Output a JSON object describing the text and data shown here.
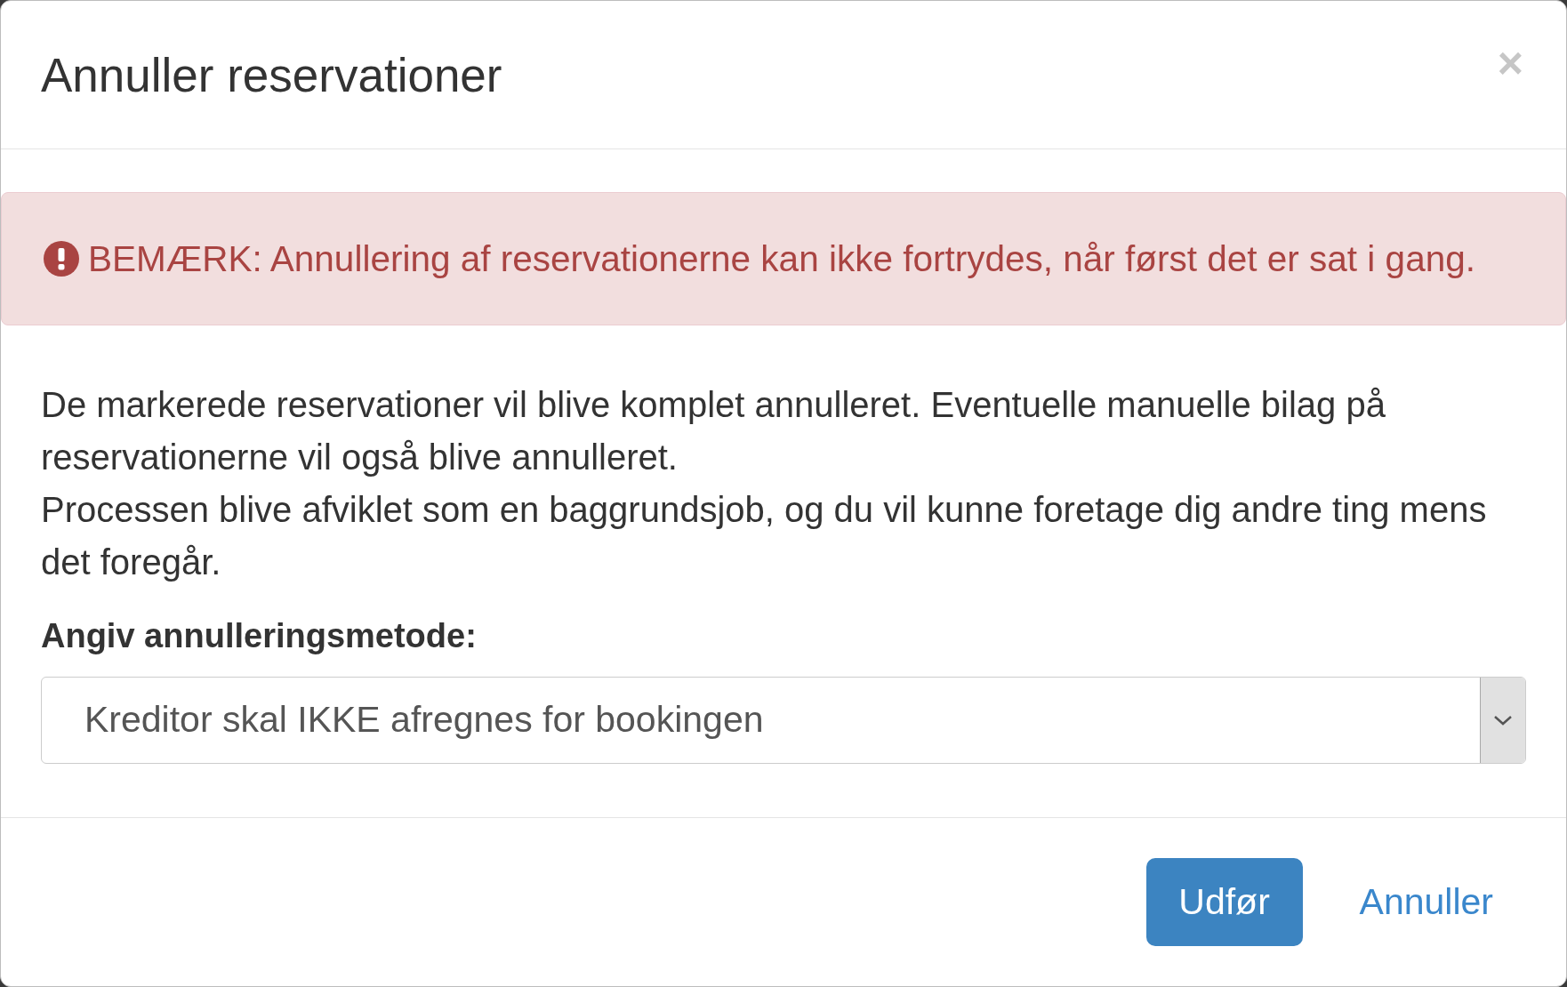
{
  "dialog": {
    "title": "Annuller reservationer",
    "close_button": "×"
  },
  "alert": {
    "kind": "danger",
    "text": "BEMÆRK: Annullering af reservationerne kan ikke fortrydes, når først det er sat i gang."
  },
  "description": [
    "De markerede reservationer vil blive komplet annulleret. Eventuelle manuelle bilag på reservationerne vil også blive annulleret.",
    "Processen blive afviklet som en baggrundsjob, og du vil kunne foretage dig andre ting mens det foregår."
  ],
  "cancellation_method": {
    "label": "Angiv annulleringsmetode:",
    "value": "Kreditor skal IKKE afregnes for bookingen"
  },
  "buttons": [
    {
      "label": "Udfør",
      "kind": "primary"
    },
    {
      "label": "Annuller",
      "kind": "link"
    }
  ]
}
